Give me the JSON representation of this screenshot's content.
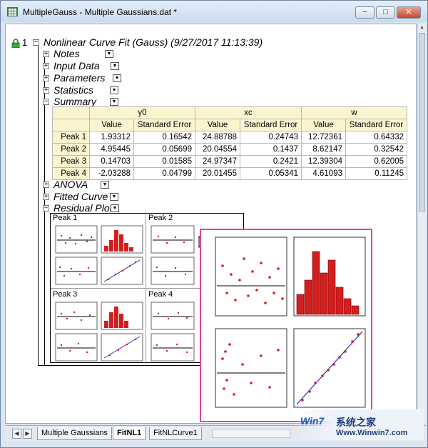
{
  "window": {
    "title": "MultipleGauss - Multiple Gaussians.dat *",
    "min_glyph": "−",
    "max_glyph": "□",
    "close_glyph": "✕"
  },
  "report": {
    "number": "1",
    "title": "Nonlinear Curve Fit (Gauss) (9/27/2017 11:13:39)",
    "sections": {
      "notes": "Notes",
      "input_data": "Input Data",
      "parameters": "Parameters",
      "statistics": "Statistics",
      "summary": "Summary",
      "anova": "ANOVA",
      "fitted_curve": "Fitted Curve",
      "residual_plot": "Residual Plot"
    }
  },
  "summary_table": {
    "groups": [
      "y0",
      "xc",
      "w"
    ],
    "subheaders": [
      "Value",
      "Standard Error",
      "Value",
      "Standard Error",
      "Value",
      "Standard Error"
    ],
    "rows": [
      {
        "label": "Peak 1",
        "cells": [
          "1.93312",
          "0.16542",
          "24.88788",
          "0.24743",
          "12.72361",
          "0.64332"
        ]
      },
      {
        "label": "Peak 2",
        "cells": [
          "4.95445",
          "0.05699",
          "20.04554",
          "0.1437",
          "8.62147",
          "0.32542"
        ]
      },
      {
        "label": "Peak 3",
        "cells": [
          "0.14703",
          "0.01585",
          "24.97347",
          "0.2421",
          "12.39304",
          "0.62005"
        ]
      },
      {
        "label": "Peak 4",
        "cells": [
          "-2.03288",
          "0.04799",
          "20.01455",
          "0.05341",
          "4.61093",
          "0.11245"
        ]
      }
    ]
  },
  "residual_panels": [
    "Peak 1",
    "Peak 2",
    "Peak 3",
    "Peak 4"
  ],
  "tabs": {
    "sheet1": "Multiple Gaussians",
    "sheet2": "FitNL1",
    "sheet3": "FitNLCurve1",
    "first_glyph": "◀",
    "last_glyph": "▶"
  },
  "watermark": {
    "logo": "Win7",
    "name": "系统之家",
    "url": "Www.Winwin7.com"
  },
  "colors": {
    "header_fill": "#fbf5cf",
    "popup_border": "#e0459c",
    "plot_points": "#d11f1f",
    "fit_line": "#1f2fd1"
  }
}
